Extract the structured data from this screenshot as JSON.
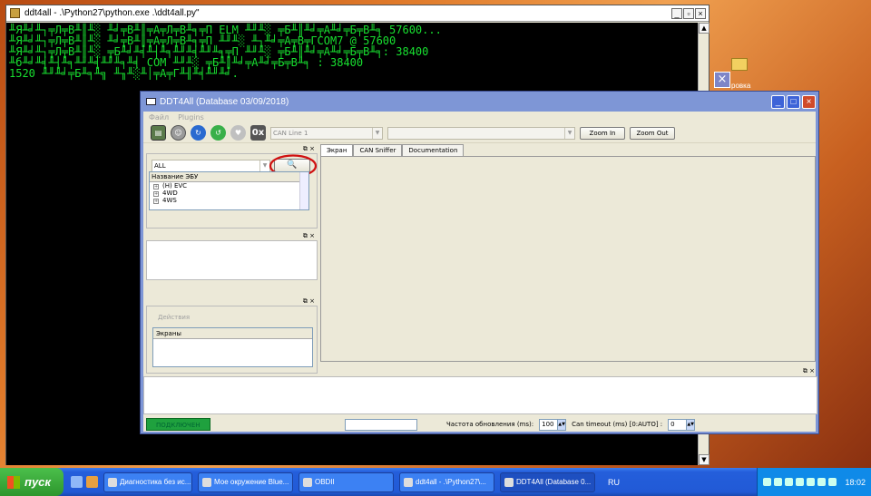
{
  "console": {
    "title": "ddt4all - .\\Python27\\python.exe .\\ddt4all.py\"",
    "lines": [
      "╨Я╨╛╨┐╤Л╤В╨║╨░ ╨╛╤В╨║╤А╤Л╤В╨╕╤П ELM ╨╜╨░ ╤Б╨║╨╛╤А╨╛╤Б╤В╨╕ 57600...",
      "╨Я╨╛╨┐╤Л╤В╨║╨░ ╨╛╤В╨║╤А╤Л╤В╨╕╤П ╨╜╨░ ╨┐╨╛╤А╤В╤ГCOM7 @ 57600",
      "╨Я╨╛╨┐╤Л╤В╨║╨░ ╤Б╨╛╨╡╨┤╨╕╨╜╨╡╨╜╨╕╤П ╨╜╨░ ╤Б╨║╨╛╤А╨╛╤Б╤В╨╕: 38400",
      "╨б╨╛╨╡╨┤╨╕╨╜╨╡╨╜╨╕╨╡ COM ╨╜╨░ ╤Б╨║╨╛╤А╨╛╤Б╤В╨╕ : 38400",
      "1520 ╨╜╨╛╤Б╨╕╨╗ ╨╖╨░╨│╤А╤Г╨╢╨╡╨╜╨╛."
    ]
  },
  "desktop": {
    "folder_label": "ровка"
  },
  "app": {
    "title": "DDT4All (Database 03/09/2018)",
    "menu": [
      "Файл",
      "Plugins"
    ],
    "can_line": "CAN Line 1",
    "zoom_in": "Zoom In",
    "zoom_out": "Zoom Out",
    "toolbar_0x": "0x",
    "ecu_filter": "ALL",
    "ecu_list_header": "Название ЭБУ",
    "ecu_items": [
      "(H) EVC",
      "4WD",
      "4WS"
    ],
    "actions_label": "Действия",
    "screens_header": "Экраны",
    "tabs": [
      "Экран",
      "CAN Sniffer",
      "Documentation"
    ],
    "status": {
      "connected": "ПОДКЛЮЧЕН",
      "refresh_label": "Частота обновления (ms):",
      "refresh_value": "100",
      "can_timeout_label": "Can timeout (ms) [0:AUTO] :",
      "can_timeout_value": "0"
    }
  },
  "taskbar": {
    "start": "пуск",
    "tasks": [
      "Диагностика без ис...",
      "Мое окружение Blue...",
      "OBDII",
      "ddt4all - .\\Python27\\...",
      "DDT4All (Database 0..."
    ],
    "lang": "RU",
    "time": "18:02"
  }
}
